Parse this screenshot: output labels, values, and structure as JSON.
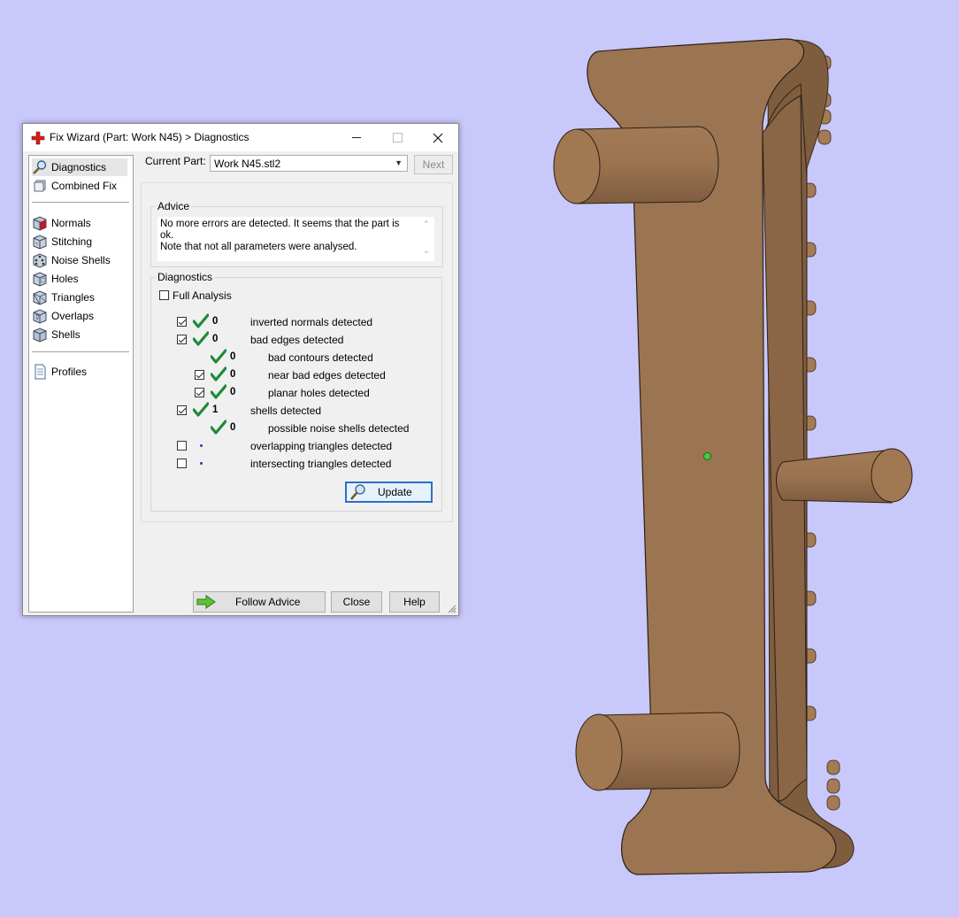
{
  "window": {
    "title": "Fix Wizard (Part: Work N45) > Diagnostics",
    "controls": {
      "minimize": "minimize",
      "maximize": "maximize",
      "close": "close"
    }
  },
  "sidebar": {
    "items": [
      {
        "label": "Diagnostics",
        "icon": "magnifier-icon",
        "selected": true
      },
      {
        "label": "Combined Fix",
        "icon": "cube-stack-icon",
        "selected": false
      },
      {
        "label": "Normals",
        "icon": "cube-normals-icon",
        "selected": false
      },
      {
        "label": "Stitching",
        "icon": "cube-stitching-icon",
        "selected": false
      },
      {
        "label": "Noise Shells",
        "icon": "dice-icon",
        "selected": false
      },
      {
        "label": "Holes",
        "icon": "cube-holes-icon",
        "selected": false
      },
      {
        "label": "Triangles",
        "icon": "triangles-icon",
        "selected": false
      },
      {
        "label": "Overlaps",
        "icon": "cube-overlaps-icon",
        "selected": false
      },
      {
        "label": "Shells",
        "icon": "shells-icon",
        "selected": false
      },
      {
        "label": "Profiles",
        "icon": "document-icon",
        "selected": false
      }
    ]
  },
  "header": {
    "current_part_label": "Current Part:",
    "current_part_value": "Work N45.stl2",
    "next_label": "Next"
  },
  "advice": {
    "label": "Advice",
    "text": "No more errors are detected. It seems that the part is ok.\nNote that not all parameters were analysed."
  },
  "diagnostics": {
    "label": "Diagnostics",
    "full_analysis_label": "Full Analysis",
    "full_analysis_checked": false,
    "rows": [
      {
        "checkbox": true,
        "checked": true,
        "status": "ok",
        "count": "0",
        "label": "inverted normals detected"
      },
      {
        "checkbox": true,
        "checked": true,
        "status": "ok",
        "count": "0",
        "label": "bad edges detected"
      },
      {
        "checkbox": false,
        "checked": false,
        "status": "ok",
        "count": "0",
        "label": "bad contours detected"
      },
      {
        "checkbox": true,
        "checked": true,
        "status": "ok",
        "count": "0",
        "label": "near bad edges detected"
      },
      {
        "checkbox": true,
        "checked": true,
        "status": "ok",
        "count": "0",
        "label": "planar holes detected"
      },
      {
        "checkbox": true,
        "checked": true,
        "status": "ok",
        "count": "1",
        "label": "shells detected"
      },
      {
        "checkbox": false,
        "checked": false,
        "status": "ok",
        "count": "0",
        "label": "possible noise shells detected"
      },
      {
        "checkbox": true,
        "checked": false,
        "status": "none",
        "count": "",
        "label": "overlapping triangles detected"
      },
      {
        "checkbox": true,
        "checked": false,
        "status": "none",
        "count": "",
        "label": "intersecting triangles detected"
      }
    ],
    "update_label": "Update"
  },
  "footer": {
    "follow_advice_label": "Follow Advice",
    "close_label": "Close",
    "help_label": "Help"
  },
  "colors": {
    "viewport_background": "#c8c8fa",
    "model_color": "#9a7350",
    "check_green": "#1f8a3a",
    "pivot_green": "#3fd23f"
  }
}
